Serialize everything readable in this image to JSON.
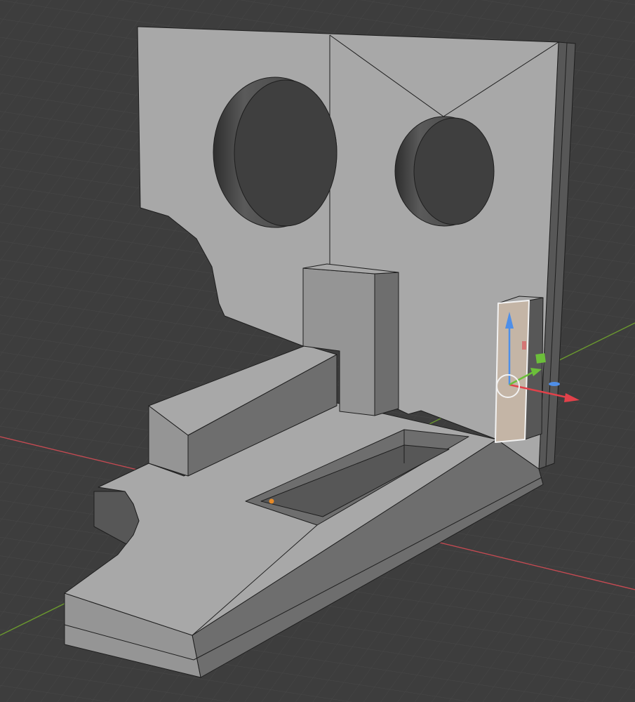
{
  "viewport": {
    "background": "#3d3d3d",
    "grid_color": "#474747",
    "x_axis_color": "#c44a52",
    "y_axis_color": "#6b9a2e"
  },
  "model": {
    "face_light": "#a8a8a8",
    "face_mid": "#959595",
    "face_dark": "#6e6e6e",
    "face_darker": "#575757",
    "hole_color": "#3f3f3f",
    "edge_color": "#1e1e1e",
    "selected_face_color": "#c4b5a6",
    "selected_outline": "#f2f2f2"
  },
  "gizmo": {
    "x_color": "#e2414a",
    "y_color": "#6cbf3a",
    "z_color": "#4f8fe8",
    "origin_color": "#e68b2a",
    "icons": [
      "arrow-x-icon",
      "arrow-y-icon",
      "arrow-z-icon",
      "plane-y-handle-icon",
      "plane-x-handle-icon",
      "plane-z-handle-icon",
      "origin-dot-icon",
      "rotate-ring-icon"
    ]
  }
}
